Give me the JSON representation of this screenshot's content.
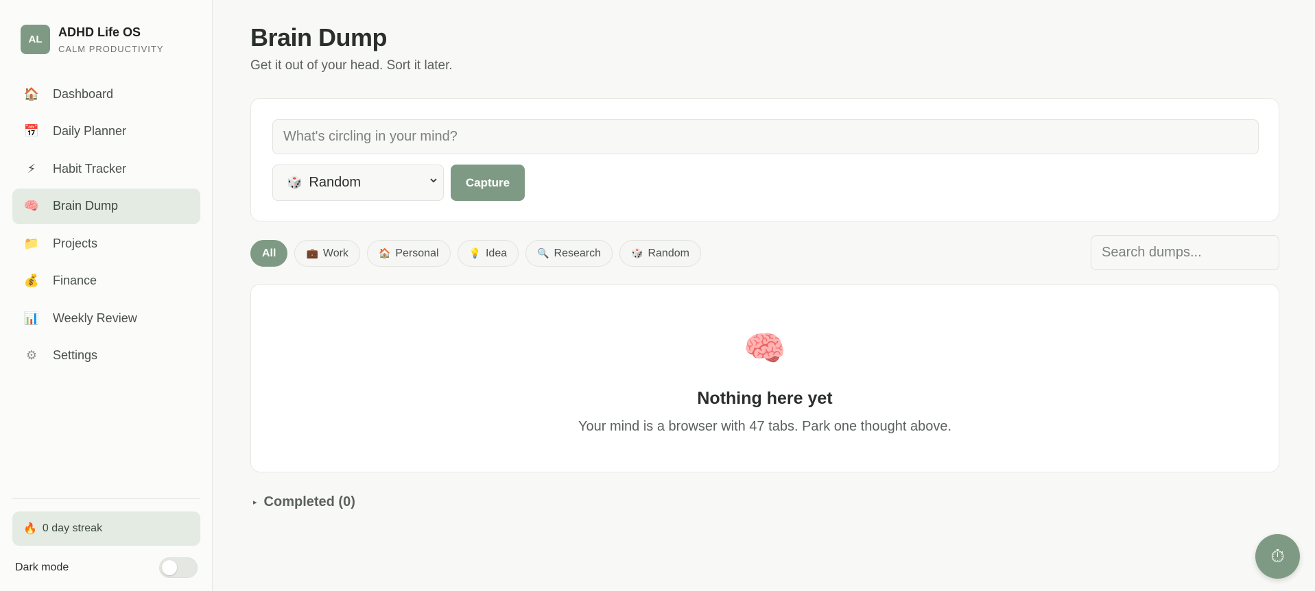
{
  "brand": {
    "avatar": "AL",
    "name": "ADHD Life OS",
    "tagline": "CALM PRODUCTIVITY"
  },
  "sidebar": {
    "items": [
      {
        "label": "Dashboard",
        "icon": "🏠",
        "icon_name": "house-icon"
      },
      {
        "label": "Daily Planner",
        "icon": "📅",
        "icon_name": "calendar-icon"
      },
      {
        "label": "Habit Tracker",
        "icon": "⚡",
        "icon_name": "lightning-icon"
      },
      {
        "label": "Brain Dump",
        "icon": "🧠",
        "icon_name": "brain-icon",
        "active": true
      },
      {
        "label": "Projects",
        "icon": "📁",
        "icon_name": "folder-icon"
      },
      {
        "label": "Finance",
        "icon": "💰",
        "icon_name": "money-bag-icon"
      },
      {
        "label": "Weekly Review",
        "icon": "📊",
        "icon_name": "bar-chart-icon"
      },
      {
        "label": "Settings",
        "icon": "⚙",
        "icon_name": "gear-icon"
      }
    ],
    "streak": {
      "icon": "🔥",
      "label": "0 day streak"
    },
    "dark_mode": {
      "label": "Dark mode",
      "enabled": false
    }
  },
  "header": {
    "title": "Brain Dump",
    "subtitle": "Get it out of your head. Sort it later."
  },
  "capture": {
    "placeholder": "What's circling in your mind?",
    "category_icon": "🎲",
    "category_value": "Random",
    "button_label": "Capture"
  },
  "filters": [
    {
      "label": "All",
      "icon": "",
      "active": true
    },
    {
      "label": "Work",
      "icon": "💼"
    },
    {
      "label": "Personal",
      "icon": "🏠"
    },
    {
      "label": "Idea",
      "icon": "💡"
    },
    {
      "label": "Research",
      "icon": "🔍"
    },
    {
      "label": "Random",
      "icon": "🎲"
    }
  ],
  "search": {
    "placeholder": "Search dumps..."
  },
  "empty_state": {
    "icon": "🧠",
    "title": "Nothing here yet",
    "text": "Your mind is a browser with 47 tabs. Park one thought above."
  },
  "completed": {
    "label": "Completed (0)",
    "toggle_glyph": "▸"
  },
  "fab": {
    "icon": "⏱",
    "icon_name": "timer-icon"
  },
  "colors": {
    "accent": "#7f9a84",
    "active_bg": "#e3ebe3",
    "page_bg": "#f8f8f6"
  }
}
